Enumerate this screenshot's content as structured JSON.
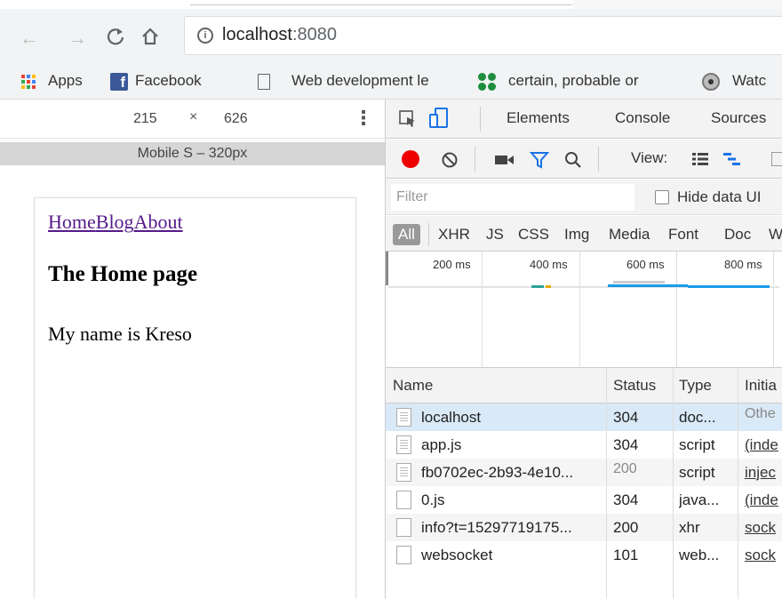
{
  "browser": {
    "url_host": "localhost",
    "url_port": ":8080",
    "bookmarks": [
      {
        "label": "Apps"
      },
      {
        "label": "Facebook"
      },
      {
        "label": "Web development le"
      },
      {
        "label": "certain, probable or"
      },
      {
        "label": "Watc"
      }
    ]
  },
  "device": {
    "width": "215",
    "x": "×",
    "height": "626",
    "media_label": "Mobile S – 320px",
    "page": {
      "links": [
        "Home",
        "Blog",
        "About"
      ],
      "heading": "The Home page",
      "paragraph": "My name is Kreso"
    }
  },
  "devtools": {
    "tabs": [
      "Elements",
      "Console",
      "Sources"
    ],
    "view_label": "View:",
    "filter_placeholder": "Filter",
    "hide_data_label": "Hide data UI",
    "types": [
      "All",
      "XHR",
      "JS",
      "CSS",
      "Img",
      "Media",
      "Font",
      "Doc",
      "W"
    ],
    "ticks": [
      "200 ms",
      "400 ms",
      "600 ms",
      "800 ms"
    ],
    "columns": [
      "Name",
      "Status",
      "Type",
      "Initia"
    ],
    "requests": [
      {
        "name": "localhost",
        "status": "304",
        "type": "doc...",
        "initiator": "Othe",
        "status_dim": false,
        "init_link": false,
        "icon": "doc"
      },
      {
        "name": "app.js",
        "status": "304",
        "type": "script",
        "initiator": "(inde",
        "status_dim": false,
        "init_link": true,
        "icon": "doc"
      },
      {
        "name": "fb0702ec-2b93-4e10...",
        "status": "200",
        "type": "script",
        "initiator": "injec",
        "status_dim": true,
        "init_link": true,
        "icon": "doc"
      },
      {
        "name": "0.js",
        "status": "304",
        "type": "java...",
        "initiator": "(inde",
        "status_dim": false,
        "init_link": true,
        "icon": "blank"
      },
      {
        "name": "info?t=15297719175...",
        "status": "200",
        "type": "xhr",
        "initiator": "sock",
        "status_dim": false,
        "init_link": true,
        "icon": "blank"
      },
      {
        "name": "websocket",
        "status": "101",
        "type": "web...",
        "initiator": "sock",
        "status_dim": false,
        "init_link": true,
        "icon": "blank"
      }
    ]
  },
  "colors": {
    "record": "#e00000",
    "filter_blue": "#1a73e8",
    "selected_row": "#dae9f8",
    "link_visited": "#551a8b"
  }
}
